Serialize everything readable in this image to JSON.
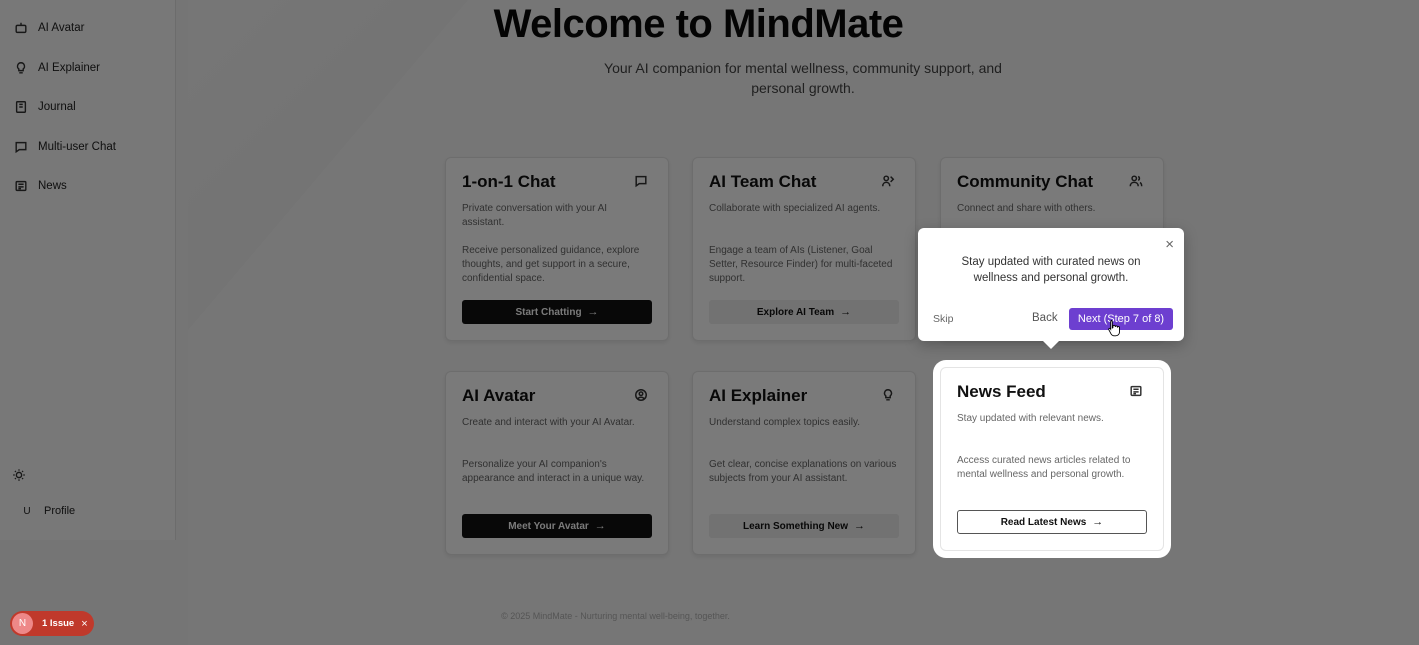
{
  "sidebar": {
    "items": [
      {
        "label": "AI Avatar",
        "icon": "robot-icon"
      },
      {
        "label": "AI Explainer",
        "icon": "lightbulb-icon"
      },
      {
        "label": "Journal",
        "icon": "journal-icon"
      },
      {
        "label": "Multi-user Chat",
        "icon": "chat-icon"
      },
      {
        "label": "News",
        "icon": "newspaper-icon"
      }
    ],
    "profile_avatar": "U",
    "profile_label": "Profile"
  },
  "hero": {
    "title": "Welcome to MindMate",
    "subtitle": "Your AI companion for mental wellness, community support, and personal growth."
  },
  "cards": [
    {
      "title": "1-on-1 Chat",
      "desc": "Private conversation with your AI assistant.",
      "body": "Receive personalized guidance, explore thoughts, and get support in a secure, confidential space.",
      "button": "Start Chatting"
    },
    {
      "title": "AI Team Chat",
      "desc": "Collaborate with specialized AI agents.",
      "body": "Engage a team of AIs (Listener, Goal Setter, Resource Finder) for multi-faceted support.",
      "button": "Explore AI Team"
    },
    {
      "title": "Community Chat",
      "desc": "Connect and share with others.",
      "body": "",
      "button": ""
    },
    {
      "title": "AI Avatar",
      "desc": "Create and interact with your AI Avatar.",
      "body": "Personalize your AI companion's appearance and interact in a unique way.",
      "button": "Meet Your Avatar"
    },
    {
      "title": "AI Explainer",
      "desc": "Understand complex topics easily.",
      "body": "Get clear, concise explanations on various subjects from your AI assistant.",
      "button": "Learn Something New"
    },
    {
      "title": "News Feed",
      "desc": "Stay updated with relevant news.",
      "body": "Access curated news articles related to mental wellness and personal growth.",
      "button": "Read Latest News"
    }
  ],
  "tour": {
    "text": "Stay updated with curated news on wellness and personal growth.",
    "skip": "Skip",
    "back": "Back",
    "next": "Next (Step 7 of 8)",
    "close": "×",
    "accent": "#6d3fd0"
  },
  "footer": "© 2025 MindMate - Nurturing mental well-being, together.",
  "issue_badge": {
    "avatar": "N",
    "label": "1 Issue",
    "close": "×",
    "color": "#c0392b"
  }
}
